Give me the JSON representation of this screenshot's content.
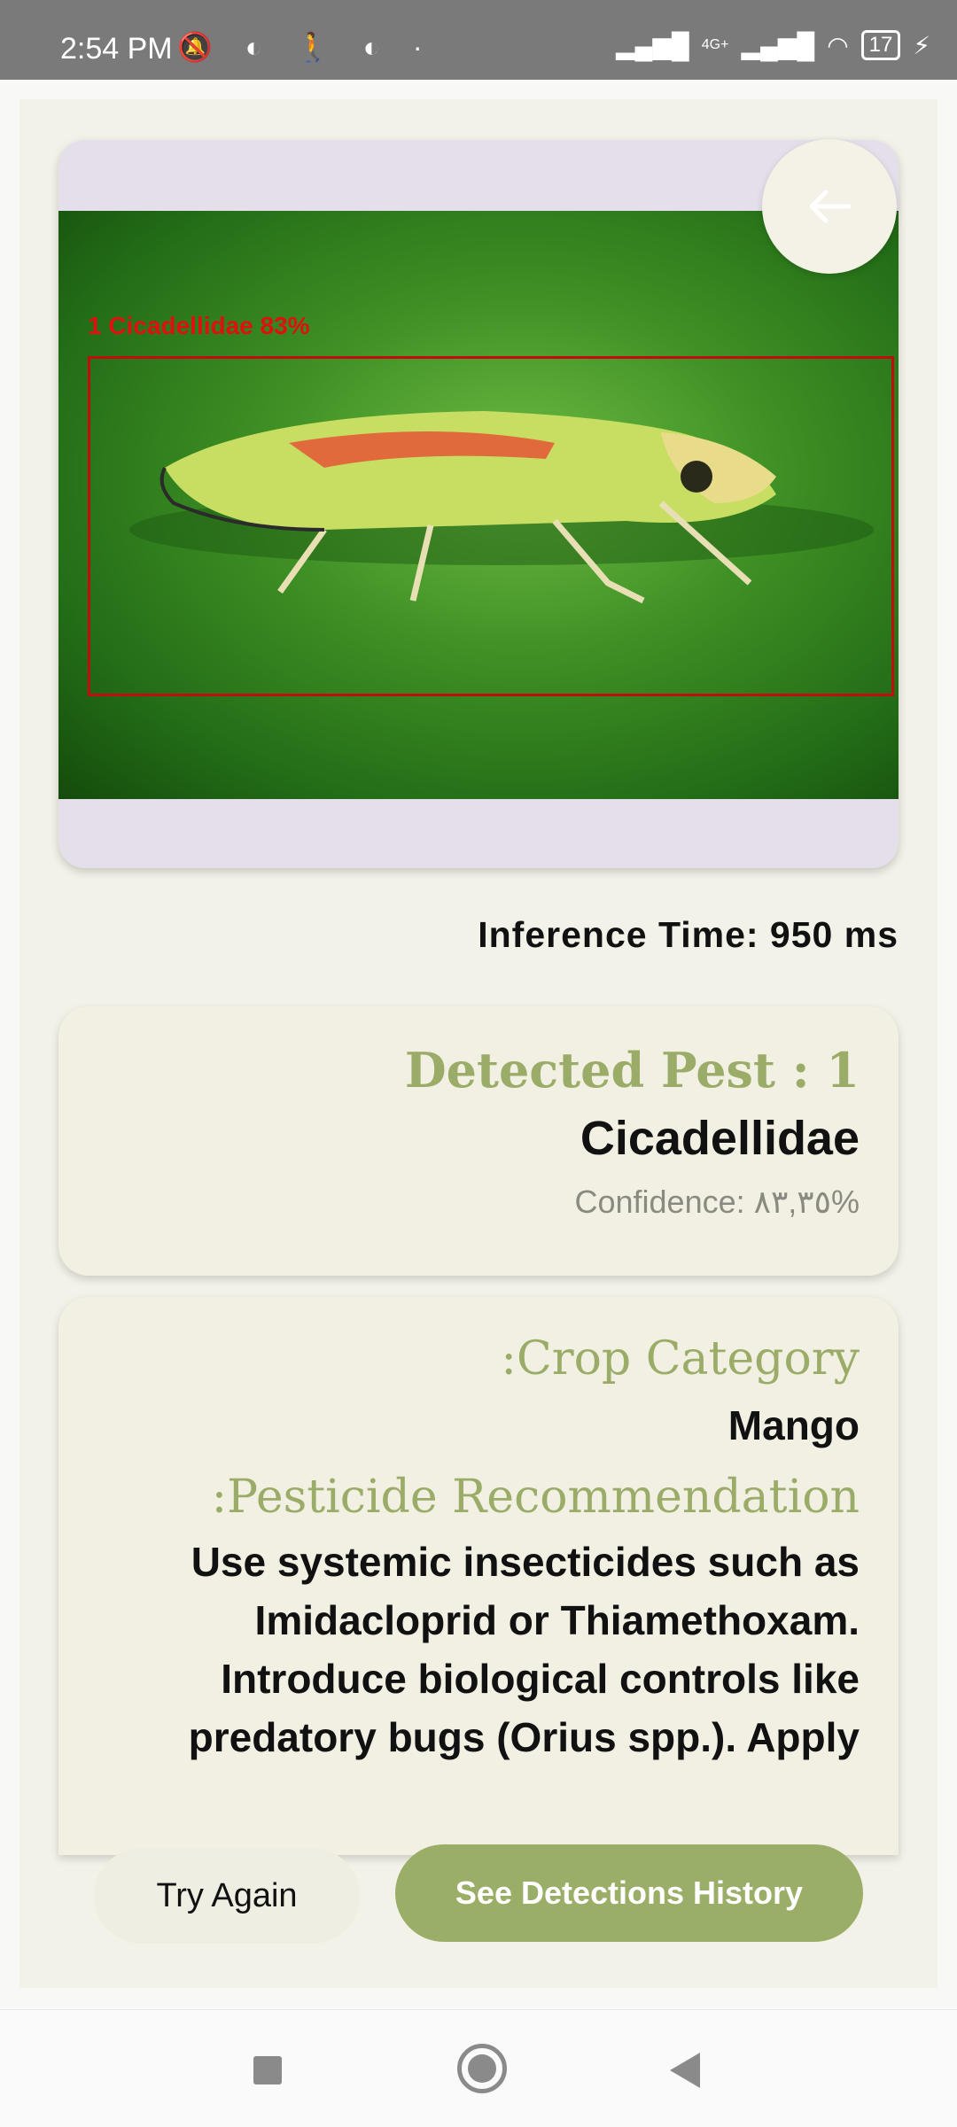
{
  "status_bar": {
    "time": "2:54 PM",
    "battery": "17",
    "network": "4G+"
  },
  "result": {
    "detection_label": "1 Cicadellidae 83%",
    "inference_time": "Inference Time: 950 ms",
    "detected_title": "Detected Pest : 1",
    "pest_name": "Cicadellidae",
    "confidence": "Confidence: ٨٣,٣٥%"
  },
  "details": {
    "crop_category_title": ":Crop Category",
    "crop_category_value": "Mango",
    "pesticide_title": ":Pesticide Recommendation",
    "pesticide_text": "Use systemic insecticides such as Imidacloprid or Thiamethoxam. Introduce biological controls like predatory bugs (Orius spp.). Apply"
  },
  "buttons": {
    "try_again": "Try Again",
    "history": "See Detections History"
  },
  "colors": {
    "accent": "#9aae68",
    "background": "#f3f2e8",
    "detection_box": "#c10d0d"
  }
}
